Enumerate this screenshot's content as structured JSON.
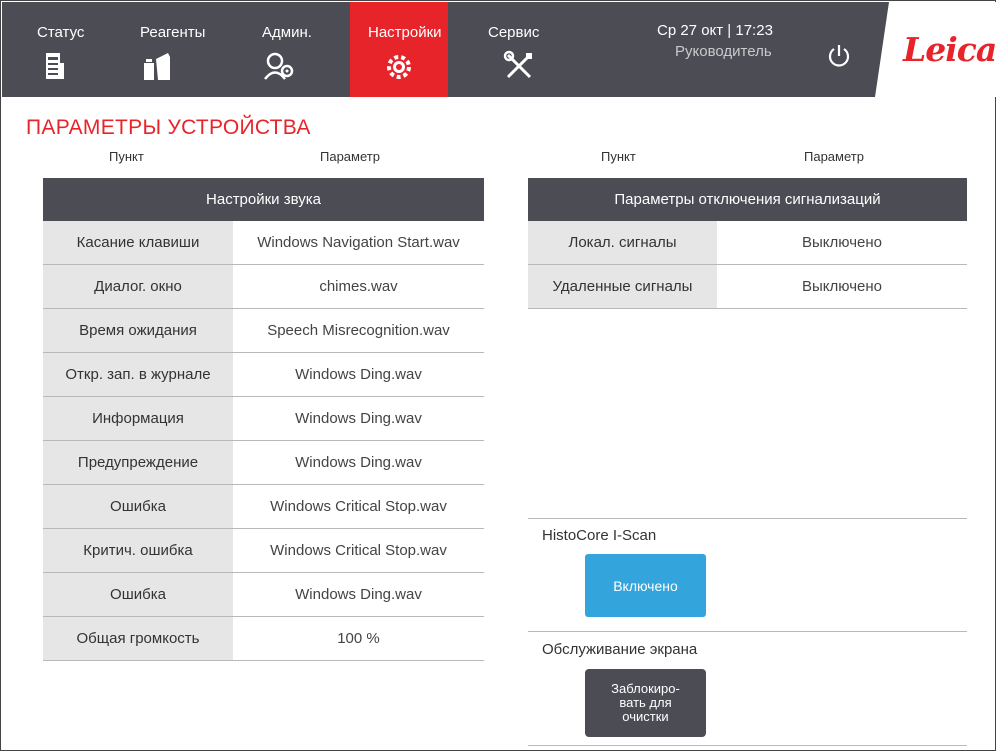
{
  "nav": {
    "tabs": [
      {
        "label": "Статус",
        "icon": "status-icon"
      },
      {
        "label": "Реагенты",
        "icon": "reagents-icon"
      },
      {
        "label": "Админ.",
        "icon": "admin-icon"
      },
      {
        "label": "Настройки",
        "icon": "settings-icon",
        "active": true
      },
      {
        "label": "Сервис",
        "icon": "service-icon"
      }
    ],
    "datetime": "Ср 27 окт | 17:23",
    "role": "Руководитель",
    "brand": "Leica"
  },
  "page": {
    "title": "ПАРАМЕТРЫ УСТРОЙСТВА",
    "col_item": "Пункт",
    "col_param": "Параметр"
  },
  "sound_table": {
    "title": "Настройки звука",
    "rows": [
      {
        "item": "Касание клавиши",
        "value": "Windows Navigation Start.wav"
      },
      {
        "item": "Диалог. окно",
        "value": "chimes.wav"
      },
      {
        "item": "Время ожидания",
        "value": "Speech Misrecognition.wav"
      },
      {
        "item": "Откр. зап. в журнале",
        "value": "Windows Ding.wav"
      },
      {
        "item": "Информация",
        "value": "Windows Ding.wav"
      },
      {
        "item": "Предупреждение",
        "value": "Windows Ding.wav"
      },
      {
        "item": "Ошибка",
        "value": "Windows Critical Stop.wav"
      },
      {
        "item": "Критич. ошибка",
        "value": "Windows Critical Stop.wav"
      },
      {
        "item": "Ошибка",
        "value": "Windows Ding.wav"
      },
      {
        "item": "Общая громкость",
        "value": "100 %"
      }
    ]
  },
  "alarm_table": {
    "title": "Параметры отключения сигнализаций",
    "rows": [
      {
        "item": "Локал. сигналы",
        "value": "Выключено"
      },
      {
        "item": "Удаленные сигналы",
        "value": "Выключено"
      }
    ]
  },
  "iscan": {
    "label": "HistoCore I-Scan",
    "button": "Включено"
  },
  "screen": {
    "label": "Обслуживание экрана",
    "button": "Заблокиро-\nвать для\nочистки"
  },
  "colors": {
    "topbar": "#4b4c54",
    "accent_red": "#e8242b",
    "button_blue": "#34a4dc",
    "row_key_bg": "#e6e6e6"
  }
}
